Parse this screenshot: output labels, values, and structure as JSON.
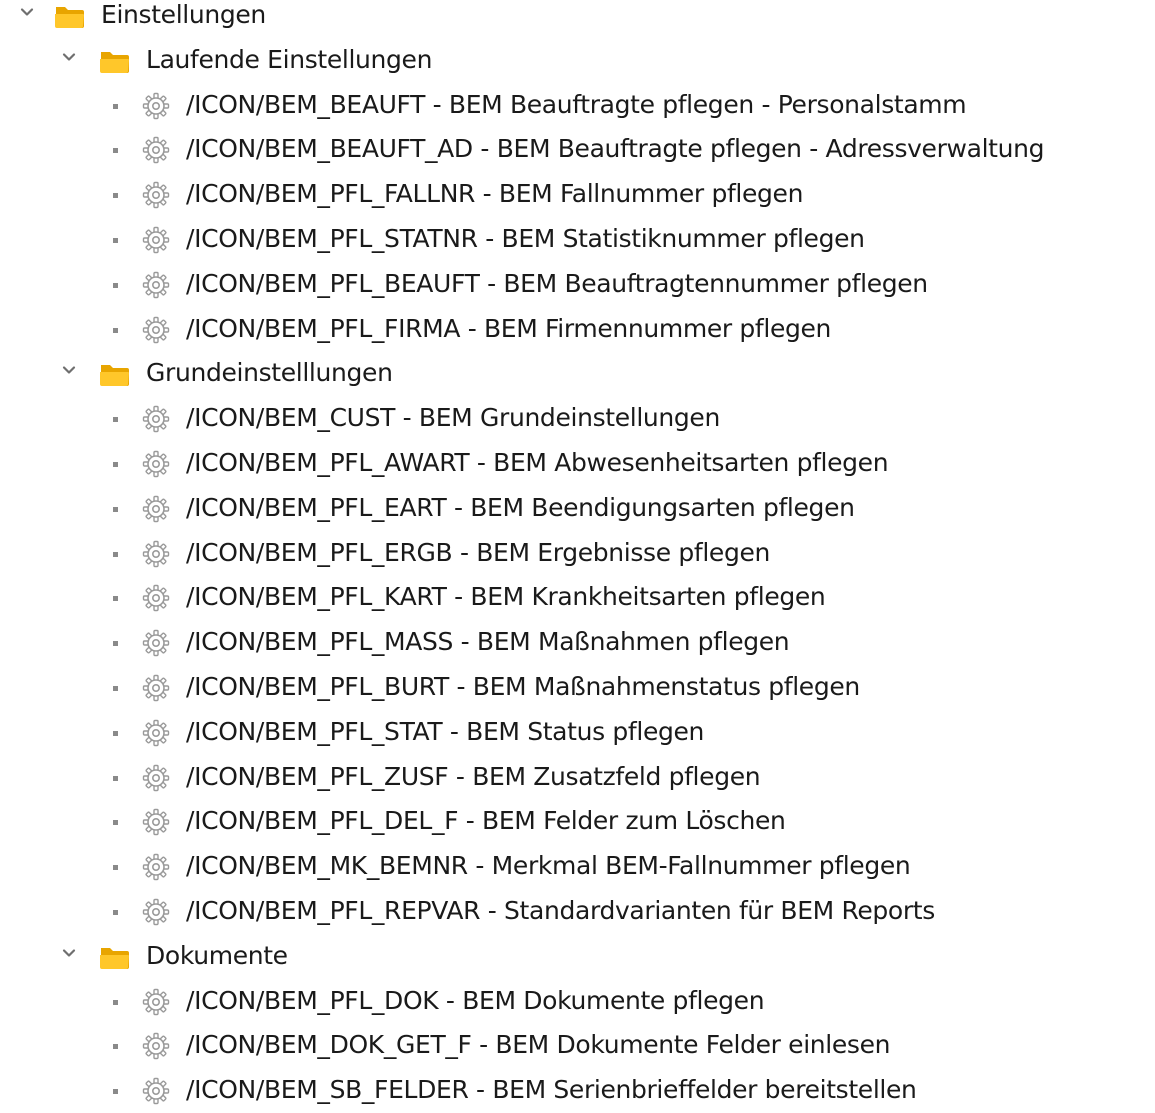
{
  "tree": {
    "root": {
      "label": "Einstellungen",
      "expanded": true,
      "icon": "folder-open-icon"
    },
    "groups": [
      {
        "label": "Laufende Einstellungen",
        "expanded": true,
        "icon": "folder-open-icon",
        "items": [
          {
            "label": "/ICON/BEM_BEAUFT - BEM Beauftragte pflegen - Personalstamm",
            "icon": "gear-icon"
          },
          {
            "label": "/ICON/BEM_BEAUFT_AD - BEM Beauftragte pflegen - Adressverwaltung",
            "icon": "gear-icon"
          },
          {
            "label": "/ICON/BEM_PFL_FALLNR - BEM Fallnummer pflegen",
            "icon": "gear-icon"
          },
          {
            "label": "/ICON/BEM_PFL_STATNR - BEM Statistiknummer pflegen",
            "icon": "gear-icon"
          },
          {
            "label": "/ICON/BEM_PFL_BEAUFT - BEM Beauftragtennummer pflegen",
            "icon": "gear-icon"
          },
          {
            "label": "/ICON/BEM_PFL_FIRMA - BEM Firmennummer pflegen",
            "icon": "gear-icon"
          }
        ]
      },
      {
        "label": "Grundeinstelllungen",
        "expanded": true,
        "icon": "folder-open-icon",
        "items": [
          {
            "label": "/ICON/BEM_CUST - BEM Grundeinstellungen",
            "icon": "gear-icon"
          },
          {
            "label": "/ICON/BEM_PFL_AWART - BEM Abwesenheitsarten pflegen",
            "icon": "gear-icon"
          },
          {
            "label": "/ICON/BEM_PFL_EART - BEM Beendigungsarten pflegen",
            "icon": "gear-icon"
          },
          {
            "label": "/ICON/BEM_PFL_ERGB - BEM Ergebnisse pflegen",
            "icon": "gear-icon"
          },
          {
            "label": "/ICON/BEM_PFL_KART - BEM Krankheitsarten pflegen",
            "icon": "gear-icon"
          },
          {
            "label": "/ICON/BEM_PFL_MASS - BEM Maßnahmen pflegen",
            "icon": "gear-icon"
          },
          {
            "label": "/ICON/BEM_PFL_BURT - BEM Maßnahmenstatus pflegen",
            "icon": "gear-icon"
          },
          {
            "label": "/ICON/BEM_PFL_STAT - BEM Status pflegen",
            "icon": "gear-icon"
          },
          {
            "label": "/ICON/BEM_PFL_ZUSF - BEM Zusatzfeld pflegen",
            "icon": "gear-icon"
          },
          {
            "label": "/ICON/BEM_PFL_DEL_F - BEM Felder zum Löschen",
            "icon": "gear-icon"
          },
          {
            "label": "/ICON/BEM_MK_BEMNR - Merkmal BEM-Fallnummer pflegen",
            "icon": "gear-icon"
          },
          {
            "label": "/ICON/BEM_PFL_REPVAR - Standardvarianten für BEM Reports",
            "icon": "gear-icon"
          }
        ]
      },
      {
        "label": "Dokumente",
        "expanded": true,
        "icon": "folder-open-icon",
        "items": [
          {
            "label": "/ICON/BEM_PFL_DOK - BEM Dokumente pflegen",
            "icon": "gear-icon"
          },
          {
            "label": "/ICON/BEM_DOK_GET_F - BEM Dokumente Felder einlesen",
            "icon": "gear-icon"
          },
          {
            "label": "/ICON/BEM_SB_FELDER - BEM Serienbrieffelder bereitstellen",
            "icon": "gear-icon"
          }
        ]
      }
    ]
  },
  "colors": {
    "text": "#1a1a1a",
    "chevron": "#6f6f6f",
    "bullet": "#8a8a8a",
    "folder_back": "#e8a500",
    "folder_front": "#ffc72a",
    "gear": "#9a9a9a"
  }
}
